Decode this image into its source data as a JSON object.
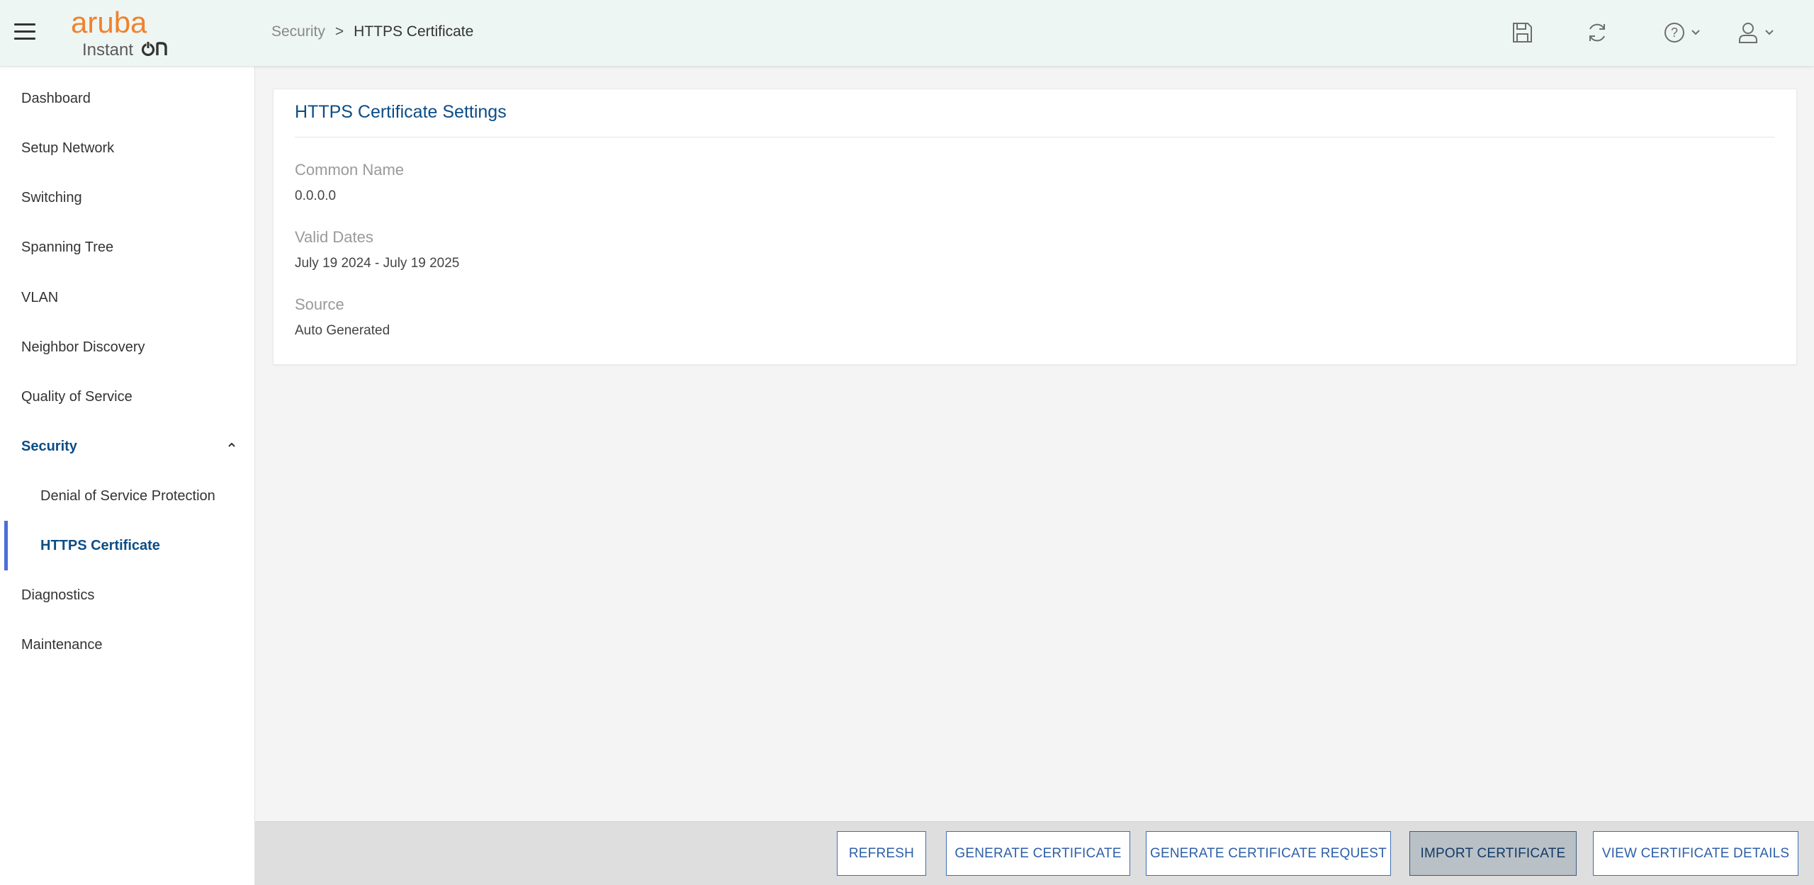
{
  "header": {
    "logo_brand": "aruba",
    "logo_product": "Instant On",
    "menu_icon": "hamburger-icon",
    "icons": [
      "save-icon",
      "refresh-icon",
      "help-icon",
      "user-icon"
    ]
  },
  "breadcrumb": {
    "parent": "Security",
    "separator": ">",
    "current": "HTTPS Certificate"
  },
  "sidebar": {
    "items": [
      {
        "label": "Dashboard"
      },
      {
        "label": "Setup Network"
      },
      {
        "label": "Switching"
      },
      {
        "label": "Spanning Tree"
      },
      {
        "label": "VLAN"
      },
      {
        "label": "Neighbor Discovery"
      },
      {
        "label": "Quality of Service"
      },
      {
        "label": "Security",
        "expanded": true
      },
      {
        "label": "Denial of Service Protection",
        "sub": true
      },
      {
        "label": "HTTPS Certificate",
        "sub": true,
        "active": true
      },
      {
        "label": "Diagnostics"
      },
      {
        "label": "Maintenance"
      }
    ]
  },
  "card": {
    "title": "HTTPS Certificate Settings",
    "fields": [
      {
        "label": "Common Name",
        "value": "0.0.0.0"
      },
      {
        "label": "Valid Dates",
        "value": "July 19 2024 - July 19 2025"
      },
      {
        "label": "Source",
        "value": "Auto Generated"
      }
    ]
  },
  "footer": {
    "buttons": [
      {
        "label": "REFRESH"
      },
      {
        "label": "GENERATE CERTIFICATE"
      },
      {
        "label": "GENERATE CERTIFICATE REQUEST"
      },
      {
        "label": "IMPORT CERTIFICATE",
        "primary": true
      },
      {
        "label": "VIEW CERTIFICATE DETAILS"
      }
    ]
  },
  "colors": {
    "accent": "#0b4d86",
    "brand_orange": "#f0822c",
    "active_bar": "#4b6fd8",
    "header_bg": "#eef6f4"
  }
}
